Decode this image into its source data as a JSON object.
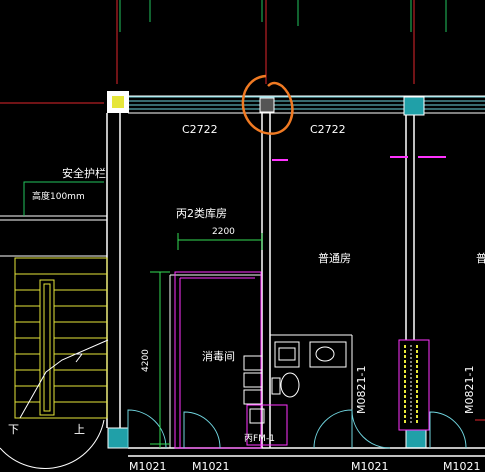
{
  "drawing": {
    "colors": {
      "background": "#000000",
      "axis_red": "#e0262b",
      "axis_green": "#22c55e",
      "wall": "#ffffff",
      "window": "#6fd3dd",
      "column": "#20a0a8",
      "magenta": "#ff33ff",
      "dimension_green": "#33dd55",
      "stair_yellow": "#e6e63a",
      "markup_orange": "#f07a23"
    },
    "labels": {
      "window_left": "C2722",
      "window_right": "C2722",
      "safety_rail": "安全护栏",
      "rail_height": "高度100mm",
      "warehouse": "丙2类库房",
      "dim_horizontal": "2200",
      "dim_vertical": "4200",
      "ordinary_room": "普通房",
      "ordinary_room_cut": "普",
      "disinfection": "消毒间",
      "door_side_1": "M0821-1",
      "door_side_2": "M0821-1",
      "stair_down": "下",
      "stair_up": "上",
      "door_bottom_1": "M1021",
      "door_bottom_2": "M1021",
      "door_bottom_3": "M1021",
      "door_bottom_4": "M1021",
      "door_fm": "丙FM-1"
    }
  }
}
